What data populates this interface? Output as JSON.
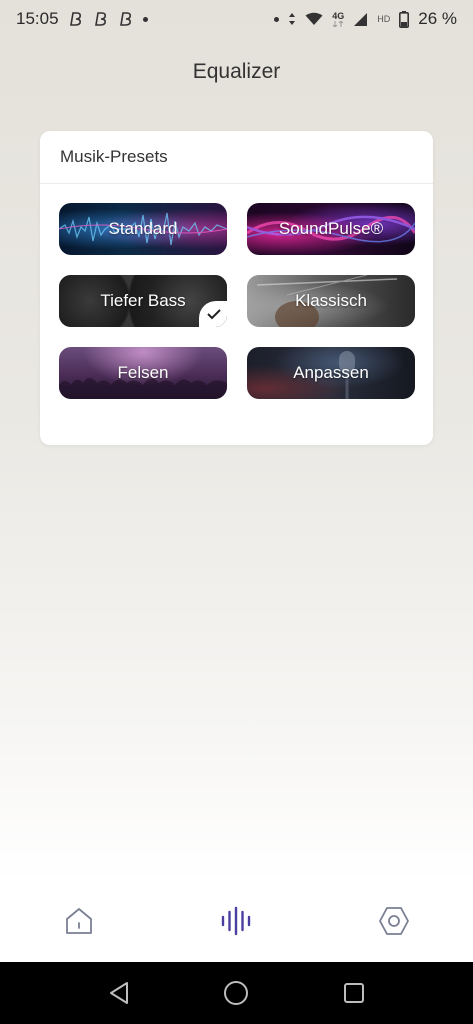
{
  "status_bar": {
    "time": "15:05",
    "network_type": "4G",
    "network_hd": "HD",
    "battery_percent": "26 %",
    "notification_icons": [
      "podcast-app-icon",
      "podcast-app-icon",
      "podcast-app-icon"
    ]
  },
  "header": {
    "title": "Equalizer"
  },
  "presets": {
    "section_title": "Musik-Presets",
    "items": [
      {
        "label": "Standard",
        "selected": false
      },
      {
        "label": "SoundPulse®",
        "selected": false
      },
      {
        "label": "Tiefer Bass",
        "selected": true
      },
      {
        "label": "Klassisch",
        "selected": false
      },
      {
        "label": "Felsen",
        "selected": false
      },
      {
        "label": "Anpassen",
        "selected": false
      }
    ]
  },
  "bottom_nav": {
    "items": [
      {
        "icon": "home-icon",
        "active": false
      },
      {
        "icon": "equalizer-icon",
        "active": true
      },
      {
        "icon": "settings-hexagon-icon",
        "active": false
      }
    ],
    "active_color": "#4a3fa0",
    "inactive_color": "#7a7f94"
  },
  "system_nav": {
    "buttons": [
      "back-icon",
      "home-circle-icon",
      "recents-icon"
    ]
  }
}
